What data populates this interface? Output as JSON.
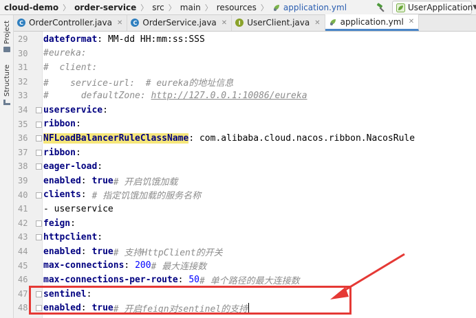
{
  "breadcrumb": {
    "project": "cloud-demo",
    "module": "order-service",
    "dirs": [
      "src",
      "main",
      "resources"
    ],
    "file": "application.yml"
  },
  "run_config": {
    "label": "UserApplication"
  },
  "left_strip": {
    "project_tab": "Project",
    "structure_tab": "Structure"
  },
  "tabs": [
    {
      "label": "OrderController.java",
      "icon": "class-icon",
      "color": "#2f7fbf",
      "glyph": "C"
    },
    {
      "label": "OrderService.java",
      "icon": "class-icon",
      "color": "#2f7fbf",
      "glyph": "C"
    },
    {
      "label": "UserClient.java",
      "icon": "interface-icon",
      "color": "#8aa22a",
      "glyph": "I"
    },
    {
      "label": "application.yml",
      "icon": "yaml-icon",
      "color": "#6a9a3a",
      "glyph": ""
    }
  ],
  "editor": {
    "lines": [
      {
        "n": "29",
        "t": "    dateformat: MM-dd HH:mm:ss:SSS"
      },
      {
        "n": "30",
        "t": "#eureka:"
      },
      {
        "n": "31",
        "t": "#  client:"
      },
      {
        "n": "32",
        "t": "#    service-url:  # eureka的地址信息"
      },
      {
        "n": "33",
        "t": "#      defaultZone: http://127.0.0.1:10086/eureka"
      },
      {
        "n": "34",
        "t": "userservice:"
      },
      {
        "n": "35",
        "t": "  ribbon:"
      },
      {
        "n": "36",
        "t": "    NFLoadBalancerRuleClassName: com.alibaba.cloud.nacos.ribbon.NacosRule"
      },
      {
        "n": "37",
        "t": "ribbon:"
      },
      {
        "n": "38",
        "t": "  eager-load:"
      },
      {
        "n": "39",
        "t": "    enabled: true # 开启饥饿加载"
      },
      {
        "n": "40",
        "t": "    clients: # 指定饥饿加载的服务名称"
      },
      {
        "n": "41",
        "t": "      - userservice"
      },
      {
        "n": "42",
        "t": "feign:"
      },
      {
        "n": "43",
        "t": "  httpclient:"
      },
      {
        "n": "44",
        "t": "    enabled: true # 支持HttpClient的开关"
      },
      {
        "n": "45",
        "t": "    max-connections: 200 # 最大连接数"
      },
      {
        "n": "46",
        "t": "    max-connections-per-route: 50 # 单个路径的最大连接数"
      },
      {
        "n": "47",
        "t": "  sentinel:"
      },
      {
        "n": "48",
        "t": "    enabled: true # 开启feign对sentinel的支持"
      }
    ]
  },
  "colors": {
    "annotation": "#e53935",
    "accent": "#4a86c8",
    "highlight": "#f5e67a"
  }
}
